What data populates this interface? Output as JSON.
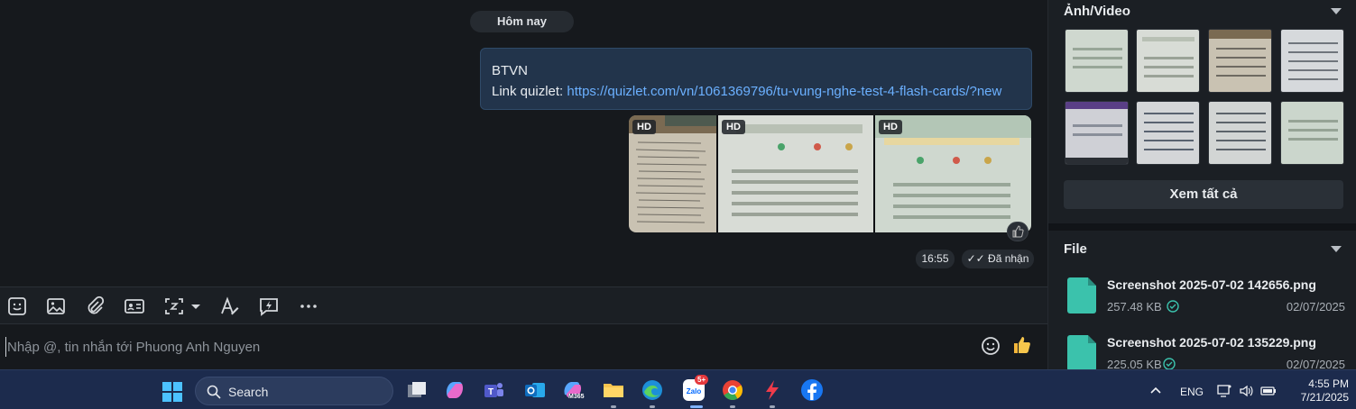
{
  "chat": {
    "date_divider": "Hôm nay",
    "message": {
      "line1": "BTVN",
      "line2_prefix": "Link quizlet: ",
      "link": "https://quizlet.com/vn/1061369796/tu-vung-nghe-test-4-flash-cards/?new"
    },
    "photos": [
      {
        "badge": "HD"
      },
      {
        "badge": "HD"
      },
      {
        "badge": "HD"
      }
    ],
    "time": "16:55",
    "status": "Đã nhận"
  },
  "toolbar": {
    "icons": [
      "sticker-icon",
      "image-icon",
      "attach-icon",
      "contact-card-icon",
      "screenshot-icon",
      "text-format-icon",
      "quick-message-icon",
      "more-icon"
    ]
  },
  "composer": {
    "placeholder": "Nhập @, tin nhắn tới Phuong Anh Nguyen"
  },
  "panel": {
    "media_title": "Ảnh/Video",
    "view_all": "Xem tất cả",
    "file_title": "File",
    "files": [
      {
        "name": "Screenshot 2025-07-02 142656.png",
        "size": "257.48 KB",
        "date": "02/07/2025"
      },
      {
        "name": "Screenshot 2025-07-02 135229.png",
        "size": "225.05 KB",
        "date": "02/07/2025"
      }
    ]
  },
  "taskbar": {
    "search_label": "Search",
    "zalo_badge": "5+",
    "m365_label": "M365",
    "language": "ENG",
    "time": "4:55 PM",
    "date": "7/21/2025"
  },
  "colors": {
    "bubble": "#22344b",
    "link": "#6bb0ff",
    "taskbar": "#1c2b4d",
    "file_icon": "#3bc2ac"
  }
}
